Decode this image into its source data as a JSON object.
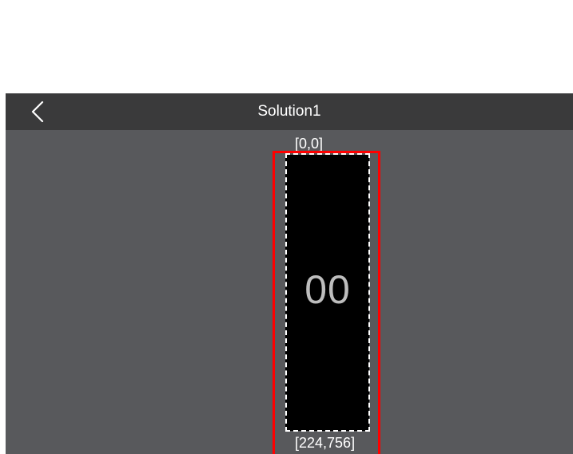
{
  "header": {
    "title": "Solution1",
    "back_icon": "chevron-left-icon"
  },
  "canvas": {
    "start_coord": "[0,0]",
    "end_coord": "[224,756]",
    "display_value": "00"
  },
  "colors": {
    "header_bg": "#3a3a3b",
    "canvas_bg": "#58595c",
    "frame_border": "#ff0000",
    "screen_bg": "#000000",
    "digit_color": "#bdbdbd"
  }
}
